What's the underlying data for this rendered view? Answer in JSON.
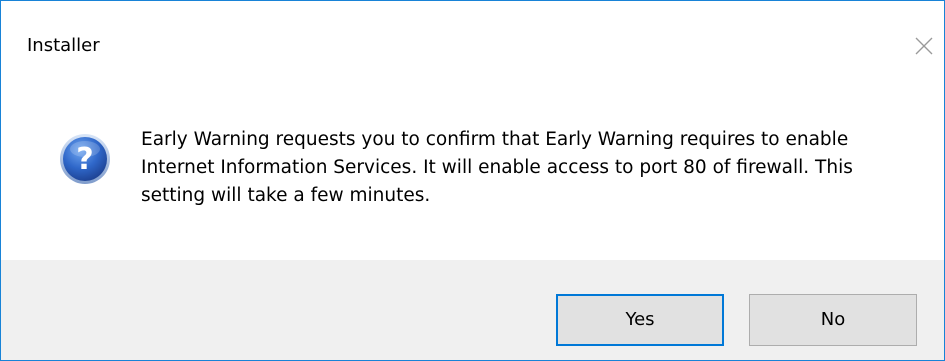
{
  "window": {
    "title": "Installer",
    "close_icon": "close-icon",
    "accent_color": "#1883d7"
  },
  "message": {
    "icon": "question-icon",
    "text": "Early Warning requests you to confirm that Early Warning requires to enable Internet Information Services. It will enable access to port 80 of firewall. This setting will take a few minutes."
  },
  "buttons": {
    "yes_label": "Yes",
    "no_label": "No",
    "default": "yes"
  }
}
